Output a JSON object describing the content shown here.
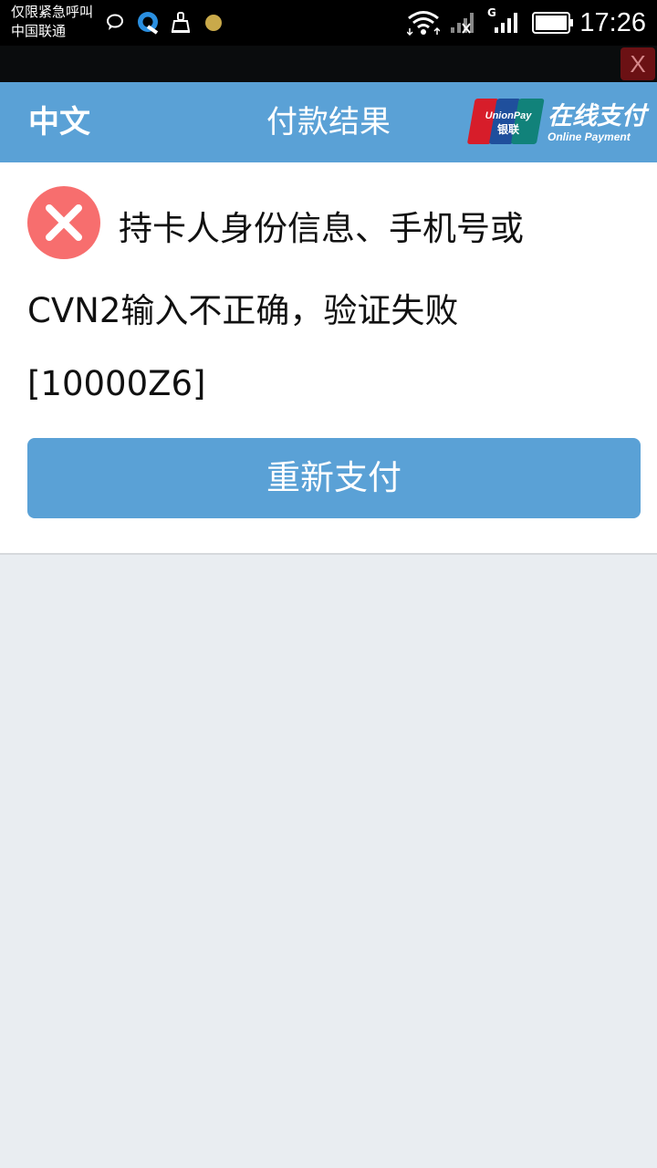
{
  "status_bar": {
    "carrier_line1": "仅限紧急呼叫",
    "carrier_line2": "中国联通",
    "network_label": "G",
    "time": "17:26",
    "icons": [
      "chat-bubble-icon",
      "browser-q-icon",
      "cleaner-icon",
      "notification-dot-icon",
      "wifi-icon",
      "signal-x-icon",
      "signal-icon",
      "battery-icon"
    ]
  },
  "overlay": {
    "close_label": "X"
  },
  "header": {
    "lang_label": "中文",
    "title": "付款结果",
    "logo": {
      "brand_en": "UnionPay",
      "brand_cn": "银联",
      "online_cn": "在线支付",
      "online_en": "Online Payment"
    }
  },
  "result": {
    "icon": "error-x-icon",
    "line1": "持卡人身份信息、手机号或",
    "line2": "CVN2输入不正确，验证失败",
    "line3": "[10000Z6]",
    "retry_label": "重新支付"
  },
  "colors": {
    "header_bg": "#5aa1d6",
    "error_icon": "#f76e6e",
    "page_bg": "#e9edf1"
  }
}
